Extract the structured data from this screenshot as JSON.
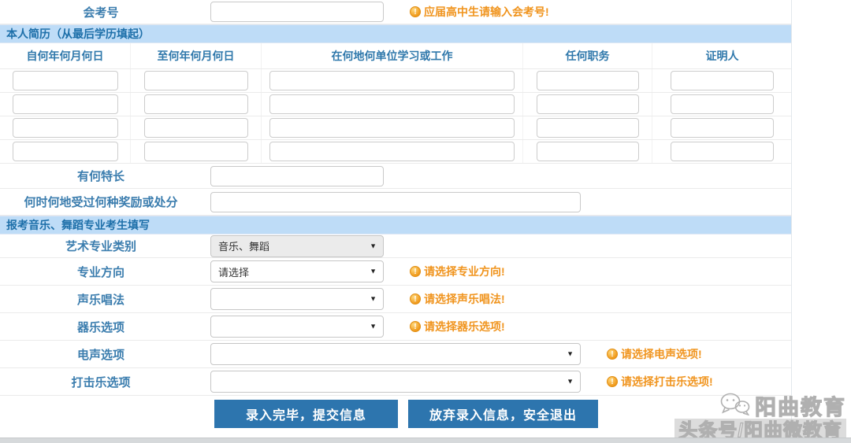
{
  "colors": {
    "accent_blue": "#3b7dae",
    "band_bg": "#bedcf7",
    "band_text": "#1d6fa9",
    "hint_orange": "#f0941e",
    "button_blue": "#2d75ae"
  },
  "exam": {
    "label": "会考号",
    "hint": "应届高中生请输入会考号!"
  },
  "resume": {
    "title": "本人简历（从最后学历填起）",
    "columns": [
      "自何年何月何日",
      "至何年何月何日",
      "在何地何单位学习或工作",
      "任何职务",
      "证明人"
    ],
    "row_count": 4
  },
  "extra": {
    "specialty_label": "有何特长",
    "award_label": "何时何地受过何种奖励或处分"
  },
  "music": {
    "title": "报考音乐、舞蹈专业考生填写",
    "rows": [
      {
        "label": "艺术专业类别",
        "value": "音乐、舞蹈",
        "hint": ""
      },
      {
        "label": "专业方向",
        "value": "请选择",
        "hint": "请选择专业方向!"
      },
      {
        "label": "声乐唱法",
        "value": "",
        "hint": "请选择声乐唱法!"
      },
      {
        "label": "器乐选项",
        "value": "",
        "hint": "请选择器乐选项!"
      },
      {
        "label": "电声选项",
        "value": "",
        "hint": "请选择电声选项!"
      },
      {
        "label": "打击乐选项",
        "value": "",
        "hint": "请选择打击乐选项!"
      }
    ]
  },
  "buttons": {
    "submit": "录入完毕，提交信息",
    "cancel": "放弃录入信息，安全退出"
  },
  "watermark": {
    "brand": "阳曲教育",
    "subtitle": "头条号/阳曲微教育"
  }
}
